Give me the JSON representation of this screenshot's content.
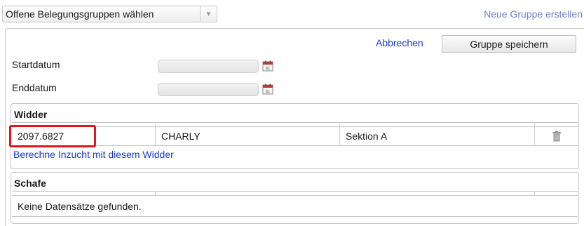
{
  "toolbar": {
    "group_select_value": "Offene Belegungsgruppen wählen",
    "group_select_arrow": "▼",
    "new_group_link": "Neue Gruppe erstellen"
  },
  "form": {
    "cancel_link": "Abbrechen",
    "save_button": "Gruppe speichern",
    "start_date_label": "Startdatum",
    "start_date_value": "",
    "end_date_label": "Enddatum",
    "end_date_value": "",
    "calendar_icon_text": "31"
  },
  "ram_section": {
    "title": "Widder",
    "rows": [
      {
        "id": "2097.6827",
        "name": "CHARLY",
        "section": "Sektion A"
      }
    ],
    "inbreeding_link": "Berechne Inzucht mit diesem Widder"
  },
  "sheep_section": {
    "title": "Schafe",
    "empty_message": "Keine Datensätze gefunden."
  },
  "colors": {
    "link_blue": "#1d35d8",
    "link_light_blue": "#6f7fd0",
    "highlight_red": "#e5141a",
    "border_gray": "#c6c6c6"
  }
}
